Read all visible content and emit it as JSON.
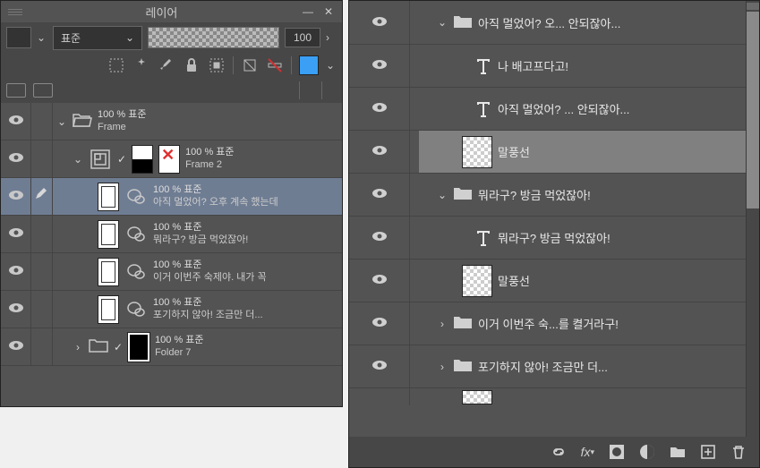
{
  "leftPanel": {
    "title": "레이어",
    "blendMode": "표준",
    "opacity": "100",
    "layers": {
      "frame": {
        "meta": "100 % 표준",
        "name": "Frame"
      },
      "frame2": {
        "meta": "100 % 표준",
        "name": "Frame 2"
      },
      "item1": {
        "meta": "100 % 표준",
        "name": "아직 멀었어? 오후 계속 했는데"
      },
      "item2": {
        "meta": "100 % 표준",
        "name": "뭐라구? 방금 먹었잖아!"
      },
      "item3": {
        "meta": "100 % 표준",
        "name": "이거 이번주 숙제야. 내가 꼭 "
      },
      "item4": {
        "meta": "100 % 표준",
        "name": "포기하지 않아! 조금만 더..."
      },
      "folder7": {
        "meta": "100 % 표준",
        "name": "Folder 7"
      }
    }
  },
  "rightPanel": {
    "layers": {
      "r1": "아직 멀었어? 오...   안되잖아...",
      "r2": "나     배고프다고!",
      "r3": "아직 멀었어?  ... 안되잖아...",
      "r4": "말풍선",
      "r5": "뭐라구? 방금 먹었잖아!",
      "r6": "뭐라구? 방금 먹었잖아!",
      "r7": "말풍선",
      "r8": "이거 이번주  숙...를 켤거라구!",
      "r9": "포기하지 않아! 조금만 더..."
    },
    "fx": "fx"
  }
}
